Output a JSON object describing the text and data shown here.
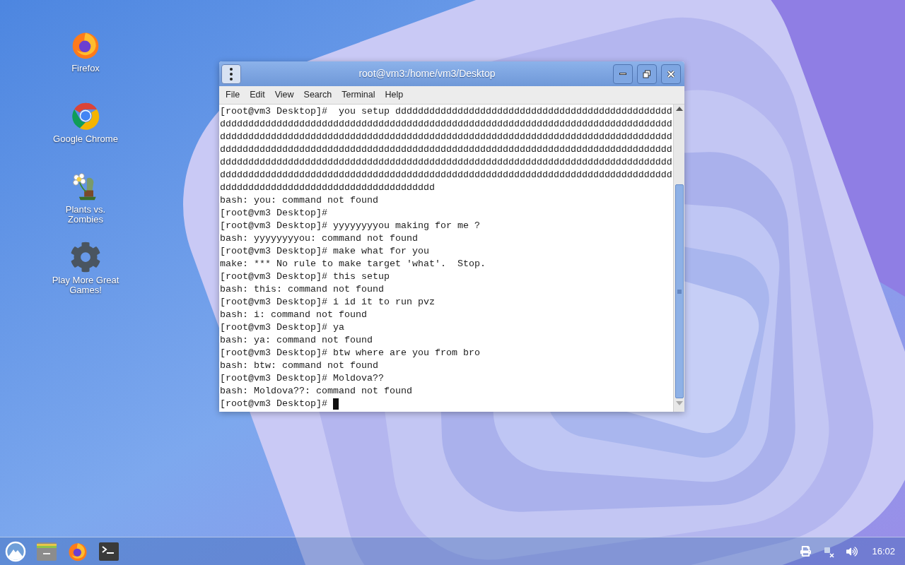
{
  "desktop_icons": [
    {
      "kind": "firefox",
      "label": "Firefox"
    },
    {
      "kind": "chrome",
      "label": "Google Chrome"
    },
    {
      "kind": "pvz",
      "label": "Plants vs. Zombies"
    },
    {
      "kind": "gear",
      "label": "Play More Great Games!"
    }
  ],
  "window": {
    "title": "root@vm3:/home/vm3/Desktop",
    "menu": [
      "File",
      "Edit",
      "View",
      "Search",
      "Terminal",
      "Help"
    ],
    "terminal_lines": [
      "[root@vm3 Desktop]#  you setup ddddddddddddddddddddddddddddddddddddddddddddddddd",
      "dddddddddddddddddddddddddddddddddddddddddddddddddddddddddddddddddddddddddddddddd",
      "dddddddddddddddddddddddddddddddddddddddddddddddddddddddddddddddddddddddddddddddd",
      "dddddddddddddddddddddddddddddddddddddddddddddddddddddddddddddddddddddddddddddddd",
      "dddddddddddddddddddddddddddddddddddddddddddddddddddddddddddddddddddddddddddddddd",
      "dddddddddddddddddddddddddddddddddddddddddddddddddddddddddddddddddddddddddddddddd",
      "dddddddddddddddddddddddddddddddddddddd",
      "bash: you: command not found",
      "[root@vm3 Desktop]#",
      "[root@vm3 Desktop]# yyyyyyyyou making for me ?",
      "bash: yyyyyyyyou: command not found",
      "[root@vm3 Desktop]# make what for you",
      "make: *** No rule to make target 'what'.  Stop.",
      "[root@vm3 Desktop]# this setup",
      "bash: this: command not found",
      "[root@vm3 Desktop]# i id it to run pvz",
      "bash: i: command not found",
      "[root@vm3 Desktop]# ya",
      "bash: ya: command not found",
      "[root@vm3 Desktop]# btw where are you from bro",
      "bash: btw: command not found",
      "[root@vm3 Desktop]# Moldova??",
      "bash: Moldova??: command not found",
      "[root@vm3 Desktop]# "
    ]
  },
  "taskbar": {
    "launchers": [
      {
        "kind": "start"
      },
      {
        "kind": "files"
      },
      {
        "kind": "firefox"
      },
      {
        "kind": "terminal"
      }
    ],
    "tray": [
      {
        "kind": "printer"
      },
      {
        "kind": "network"
      },
      {
        "kind": "volume"
      }
    ],
    "clock": "16:02"
  }
}
